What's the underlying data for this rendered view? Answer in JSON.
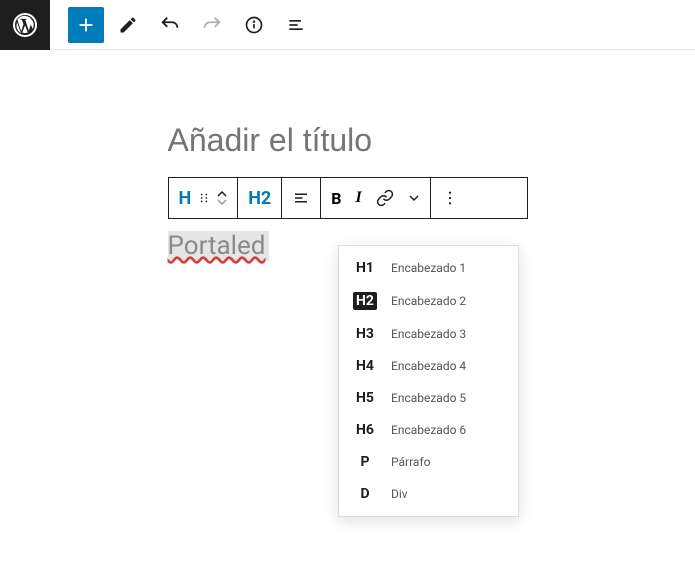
{
  "header": {
    "title_placeholder": "Añadir el título"
  },
  "content": {
    "text": "Portaled"
  },
  "toolbar": {
    "heading_level": "H2",
    "bold": "B",
    "italic": "I"
  },
  "dropdown": {
    "items": [
      {
        "tag": "H1",
        "label": "Encabezado 1",
        "selected": false
      },
      {
        "tag": "H2",
        "label": "Encabezado 2",
        "selected": true
      },
      {
        "tag": "H3",
        "label": "Encabezado 3",
        "selected": false
      },
      {
        "tag": "H4",
        "label": "Encabezado 4",
        "selected": false
      },
      {
        "tag": "H5",
        "label": "Encabezado 5",
        "selected": false
      },
      {
        "tag": "H6",
        "label": "Encabezado 6",
        "selected": false
      },
      {
        "tag": "P",
        "label": "Párrafo",
        "selected": false
      },
      {
        "tag": "D",
        "label": "Div",
        "selected": false
      }
    ]
  }
}
